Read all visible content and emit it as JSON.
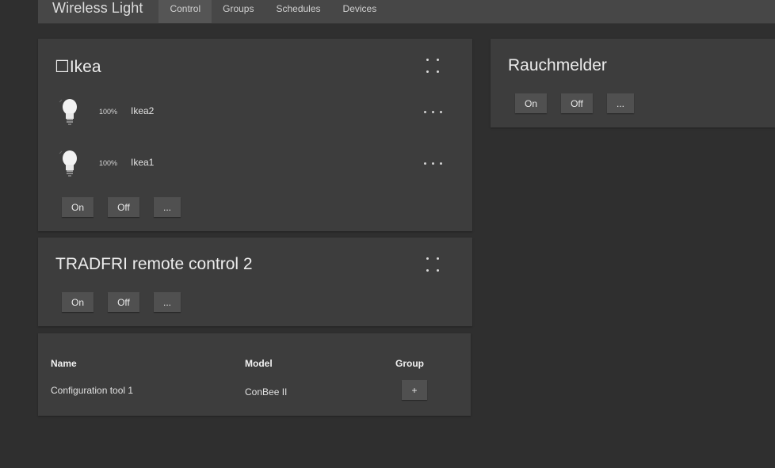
{
  "header": {
    "app_title": "Wireless Light",
    "tabs": [
      {
        "label": "Control",
        "active": true
      },
      {
        "label": "Groups",
        "active": false
      },
      {
        "label": "Schedules",
        "active": false
      },
      {
        "label": "Devices",
        "active": false
      }
    ]
  },
  "groups": [
    {
      "title": "☐Ikea",
      "lights": [
        {
          "brightness": "100%",
          "name": "Ikea2",
          "icon": "bulb-icon"
        },
        {
          "brightness": "100%",
          "name": "Ikea1",
          "icon": "bulb-icon"
        }
      ],
      "buttons": {
        "on": "On",
        "off": "Off",
        "more": "..."
      }
    },
    {
      "title": "TRADFRI remote control 2",
      "buttons": {
        "on": "On",
        "off": "Off",
        "more": "..."
      }
    },
    {
      "title": "Rauchmelder",
      "buttons": {
        "on": "On",
        "off": "Off",
        "more": "..."
      }
    }
  ],
  "devices_table": {
    "headers": {
      "name": "Name",
      "model": "Model",
      "group": "Group"
    },
    "rows": [
      {
        "name": "Configuration tool 1",
        "model": "ConBee II",
        "group_button": "+"
      }
    ]
  },
  "colors": {
    "background": "#2f2f2f",
    "card": "#3d3d3d",
    "header": "#474747",
    "button": "#505050"
  }
}
